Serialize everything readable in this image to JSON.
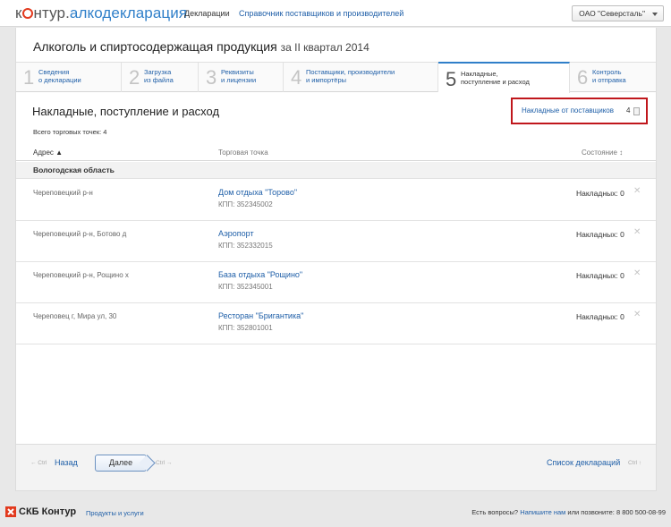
{
  "header": {
    "logo_prefix": "к",
    "logo_suffix": "нтур.",
    "logo_product": "алкодекларация",
    "nav": [
      "Декларации",
      "Справочник поставщиков и производителей"
    ],
    "org": "ОАО \"Северсталь\""
  },
  "page": {
    "title": "Алкоголь и спиртосодержащая продукция",
    "subtitle": "за II квартал 2014"
  },
  "steps": [
    {
      "num": "1",
      "line1": "Сведения",
      "line2": "о декларации"
    },
    {
      "num": "2",
      "line1": "Загрузка",
      "line2": "из файла"
    },
    {
      "num": "3",
      "line1": "Реквизиты",
      "line2": "и лицензии"
    },
    {
      "num": "4",
      "line1": "Поставщики, производители",
      "line2": "и импортёры"
    },
    {
      "num": "5",
      "line1": "Накладные,",
      "line2": "поступление и расход"
    },
    {
      "num": "6",
      "line1": "Контроль",
      "line2": "и отправка"
    }
  ],
  "section": {
    "title": "Накладные, поступление и расход",
    "suppliers_link": "Накладные от поставщиков",
    "suppliers_count": "4",
    "stat": "Всего торговых точек: 4"
  },
  "table": {
    "col_address": "Адрес ▲",
    "col_point": "Торговая точка",
    "col_state": "Состояние ↕",
    "region": "Вологодская область",
    "rows": [
      {
        "address": "Череповецкий р-н",
        "name": "Дом отдыха \"Торово\"",
        "kpp": "КПП: 352345002",
        "state": "Накладных: 0"
      },
      {
        "address": "Череповецкий р-н, Ботово д",
        "name": "Аэропорт",
        "kpp": "КПП: 352332015",
        "state": "Накладных: 0"
      },
      {
        "address": "Череповецкий р-н, Рощино х",
        "name": "База отдыха \"Рощино\"",
        "kpp": "КПП: 352345001",
        "state": "Накладных: 0"
      },
      {
        "address": "Череповец г, Мира ул, 30",
        "name": "Ресторан \"Бригантика\"",
        "kpp": "КПП: 352801001",
        "state": "Накладных: 0"
      }
    ]
  },
  "footer_nav": {
    "back_hint": "← Ctrl",
    "back": "Назад",
    "next": "Далее",
    "next_hint": "Ctrl →",
    "declarations": "Список деклараций",
    "decl_hint": "Ctrl ↑"
  },
  "bottom": {
    "brand": "СКБ Контур",
    "products": "Продукты и услуги",
    "contact_pre": "Есть вопросы?",
    "contact_link": "Напишите нам",
    "contact_post": "или позвоните: 8 800 500-08-99"
  }
}
